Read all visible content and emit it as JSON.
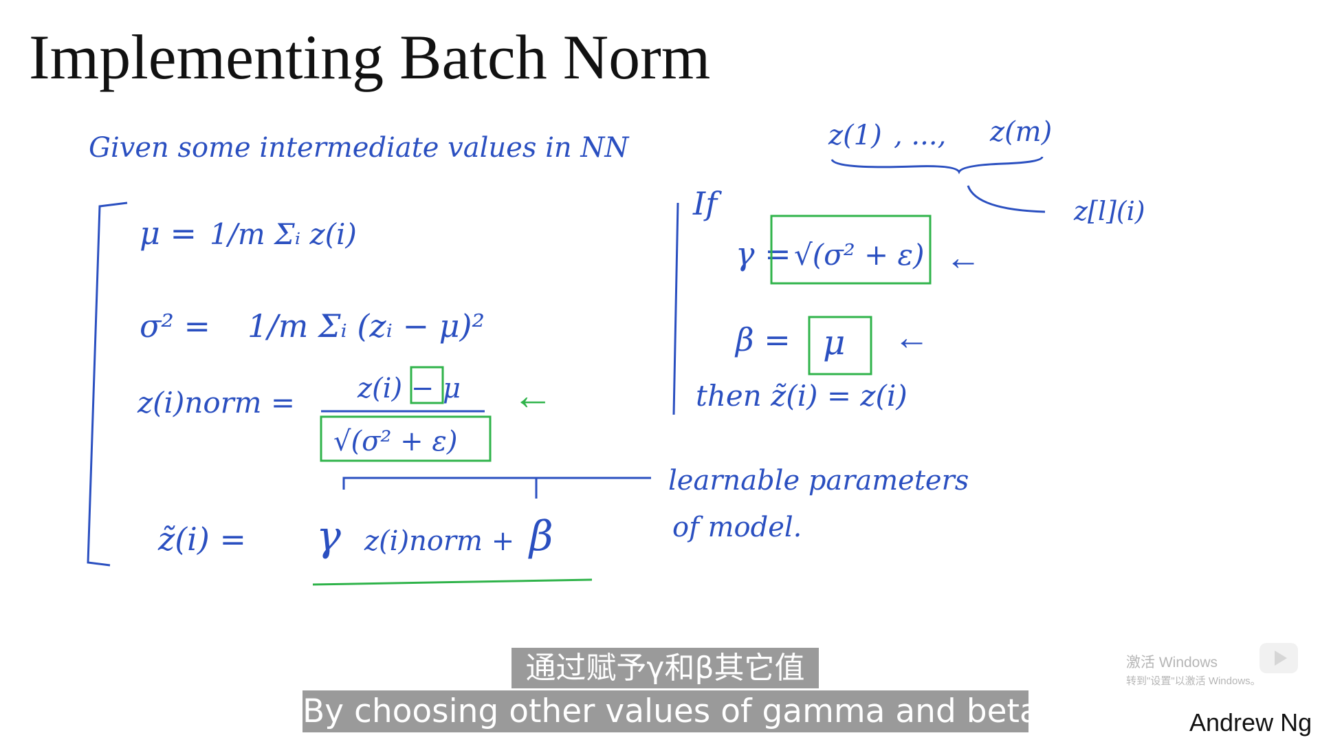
{
  "slide": {
    "title": "Implementing Batch Norm",
    "author": "Andrew Ng",
    "handwriting_color": "#2a4fc0",
    "highlight_color": "#2fb34a",
    "notes": {
      "intro": "Given some intermediate values in NN",
      "z_first": "z(1)",
      "z_dots": ", ..., ",
      "z_last": "z(m)",
      "z_layer": "z[l](i)",
      "mu_lhs": "μ =",
      "mu_rhs": "1/m Σᵢ z(i)",
      "sigma_lhs": "σ² =",
      "sigma_rhs": "1/m Σᵢ (zᵢ − μ)²",
      "znorm_lhs": "z(i)norm =",
      "znorm_num": "z(i) − μ",
      "znorm_den": "√(σ² + ε)",
      "ztilde_lhs": "z̃(i) =",
      "ztilde_gamma": "γ",
      "ztilde_mid": "z(i)norm +",
      "ztilde_beta": "β",
      "learnable_1": "learnable   parameters",
      "learnable_2": "of model.",
      "if_label": "If",
      "gamma_lhs": "γ =",
      "gamma_rhs": "√(σ² + ε)",
      "beta_lhs": "β =",
      "beta_rhs": "μ",
      "then_text": "then  z̃(i) = z(i)",
      "arrow": "←"
    }
  },
  "subtitles": {
    "zh": "通过赋予γ和β其它值",
    "en": "By choosing other values of gamma and beta,"
  },
  "watermark": {
    "line1": "激活 Windows",
    "line2": "转到\"设置\"以激活 Windows。"
  }
}
